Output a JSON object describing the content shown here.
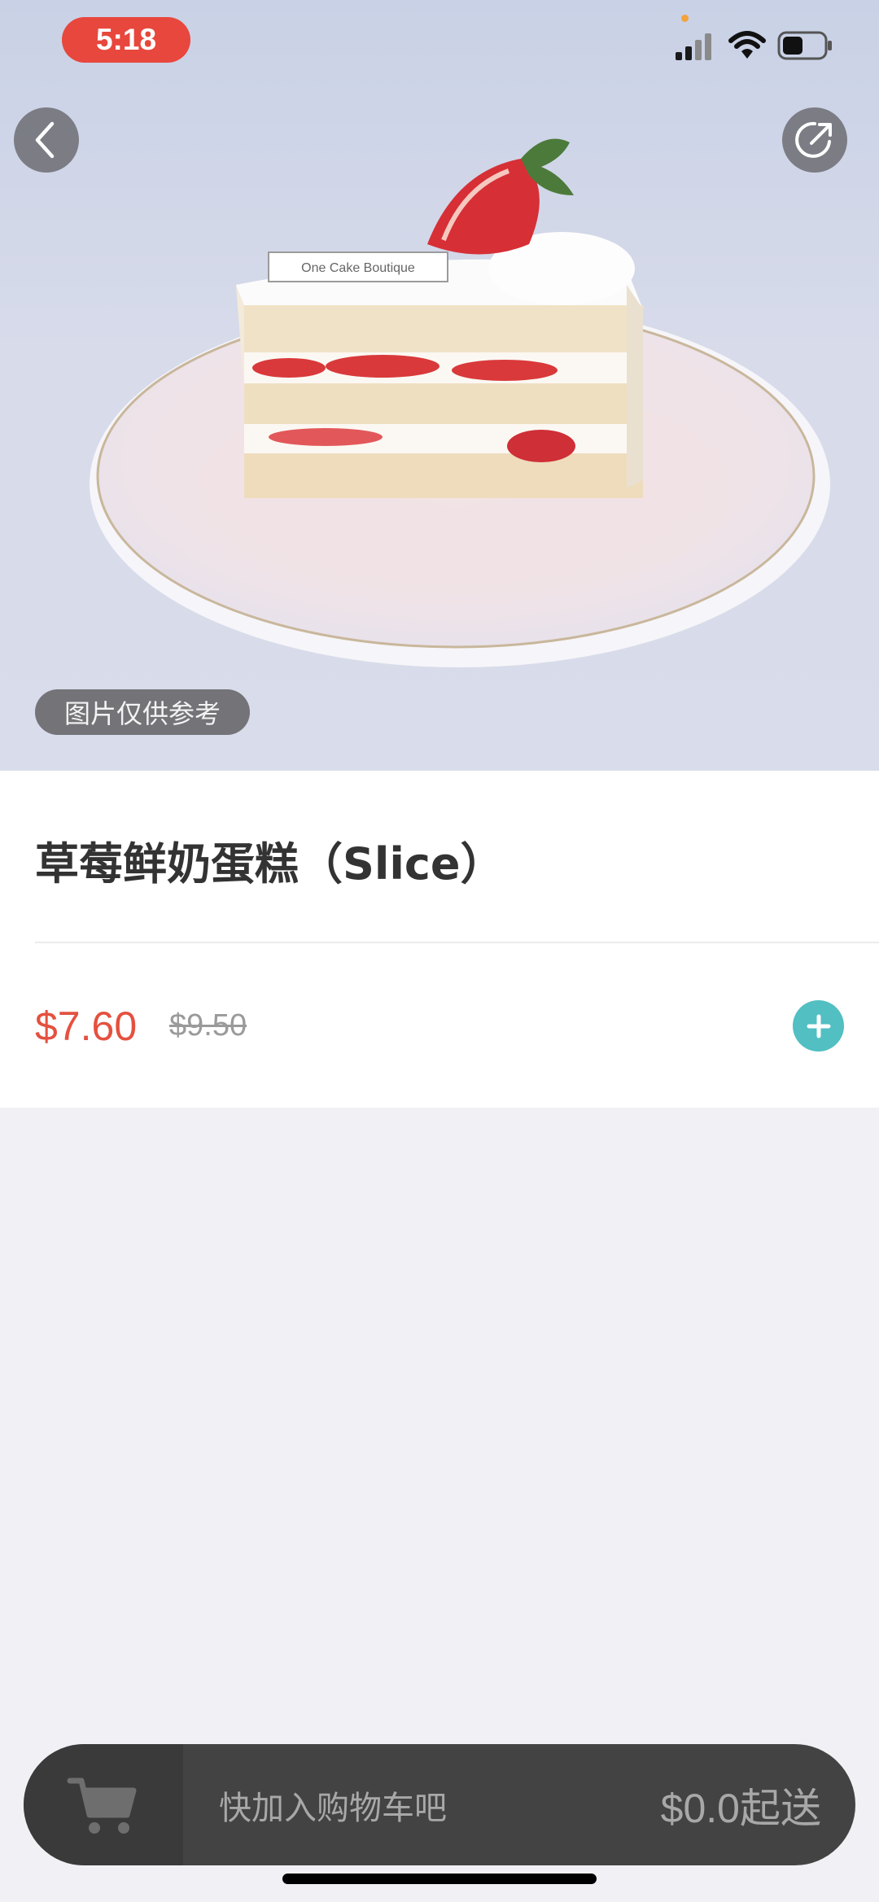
{
  "status_bar": {
    "time": "5:18"
  },
  "hero": {
    "plate_label": "One Cake Boutique",
    "photo_note": "图片仅供参考",
    "icons": {
      "back": "chevron-left-icon",
      "share": "share-icon"
    }
  },
  "product": {
    "title": "草莓鲜奶蛋糕（Slice）",
    "price": "$7.60",
    "original_price": "$9.50",
    "add_icon": "plus-icon"
  },
  "cart": {
    "hint": "快加入购物车吧",
    "minimum": "$0.0起送",
    "icon": "cart-icon"
  },
  "colors": {
    "price_red": "#e4513f",
    "accent_teal": "#52bfc2",
    "time_pill_red": "#e8473d",
    "cart_bar": "#434343"
  }
}
